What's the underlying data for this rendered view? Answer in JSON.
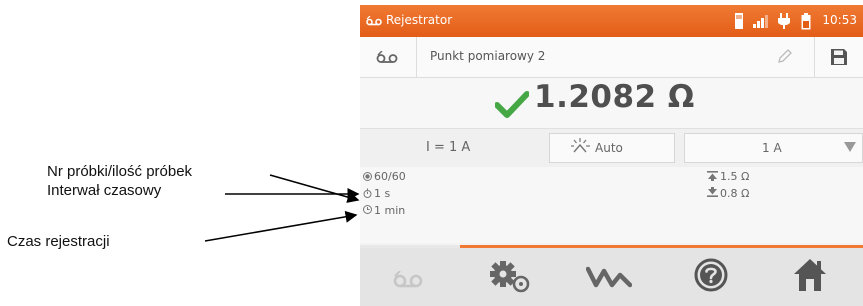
{
  "annotations": {
    "sample_label": "Nr próbki/ilość próbek",
    "interval_label": "Interwał czasowy",
    "duration_label": "Czas rejestracji"
  },
  "status_bar": {
    "app_icon": "recorder-icon",
    "app_title": "Rejestrator",
    "icons": [
      "memory-card-icon",
      "signal-icon",
      "plug-icon",
      "battery-icon"
    ],
    "time": "10:53",
    "accent_color": "#ef6c22"
  },
  "header": {
    "recorder_icon": "recorder-icon",
    "point_name": "Punkt pomiarowy 2",
    "edit_icon": "pencil-icon",
    "save_icon": "save-icon"
  },
  "result": {
    "status_icon": "checkmark-icon",
    "status_color": "#43a047",
    "value": "1.2082 Ω"
  },
  "settings": {
    "current": "I = 1 A",
    "mode_icon": "auto-mode-icon",
    "mode": "Auto",
    "range": "1 A"
  },
  "info": {
    "samples": "60/60",
    "interval": "1 s",
    "duration": "1 min",
    "upper_limit": "1.5 Ω",
    "lower_limit": "0.8 Ω"
  },
  "bottom_nav": {
    "items": [
      "recorder-icon",
      "settings-icon",
      "graph-icon",
      "help-icon",
      "home-icon"
    ]
  }
}
